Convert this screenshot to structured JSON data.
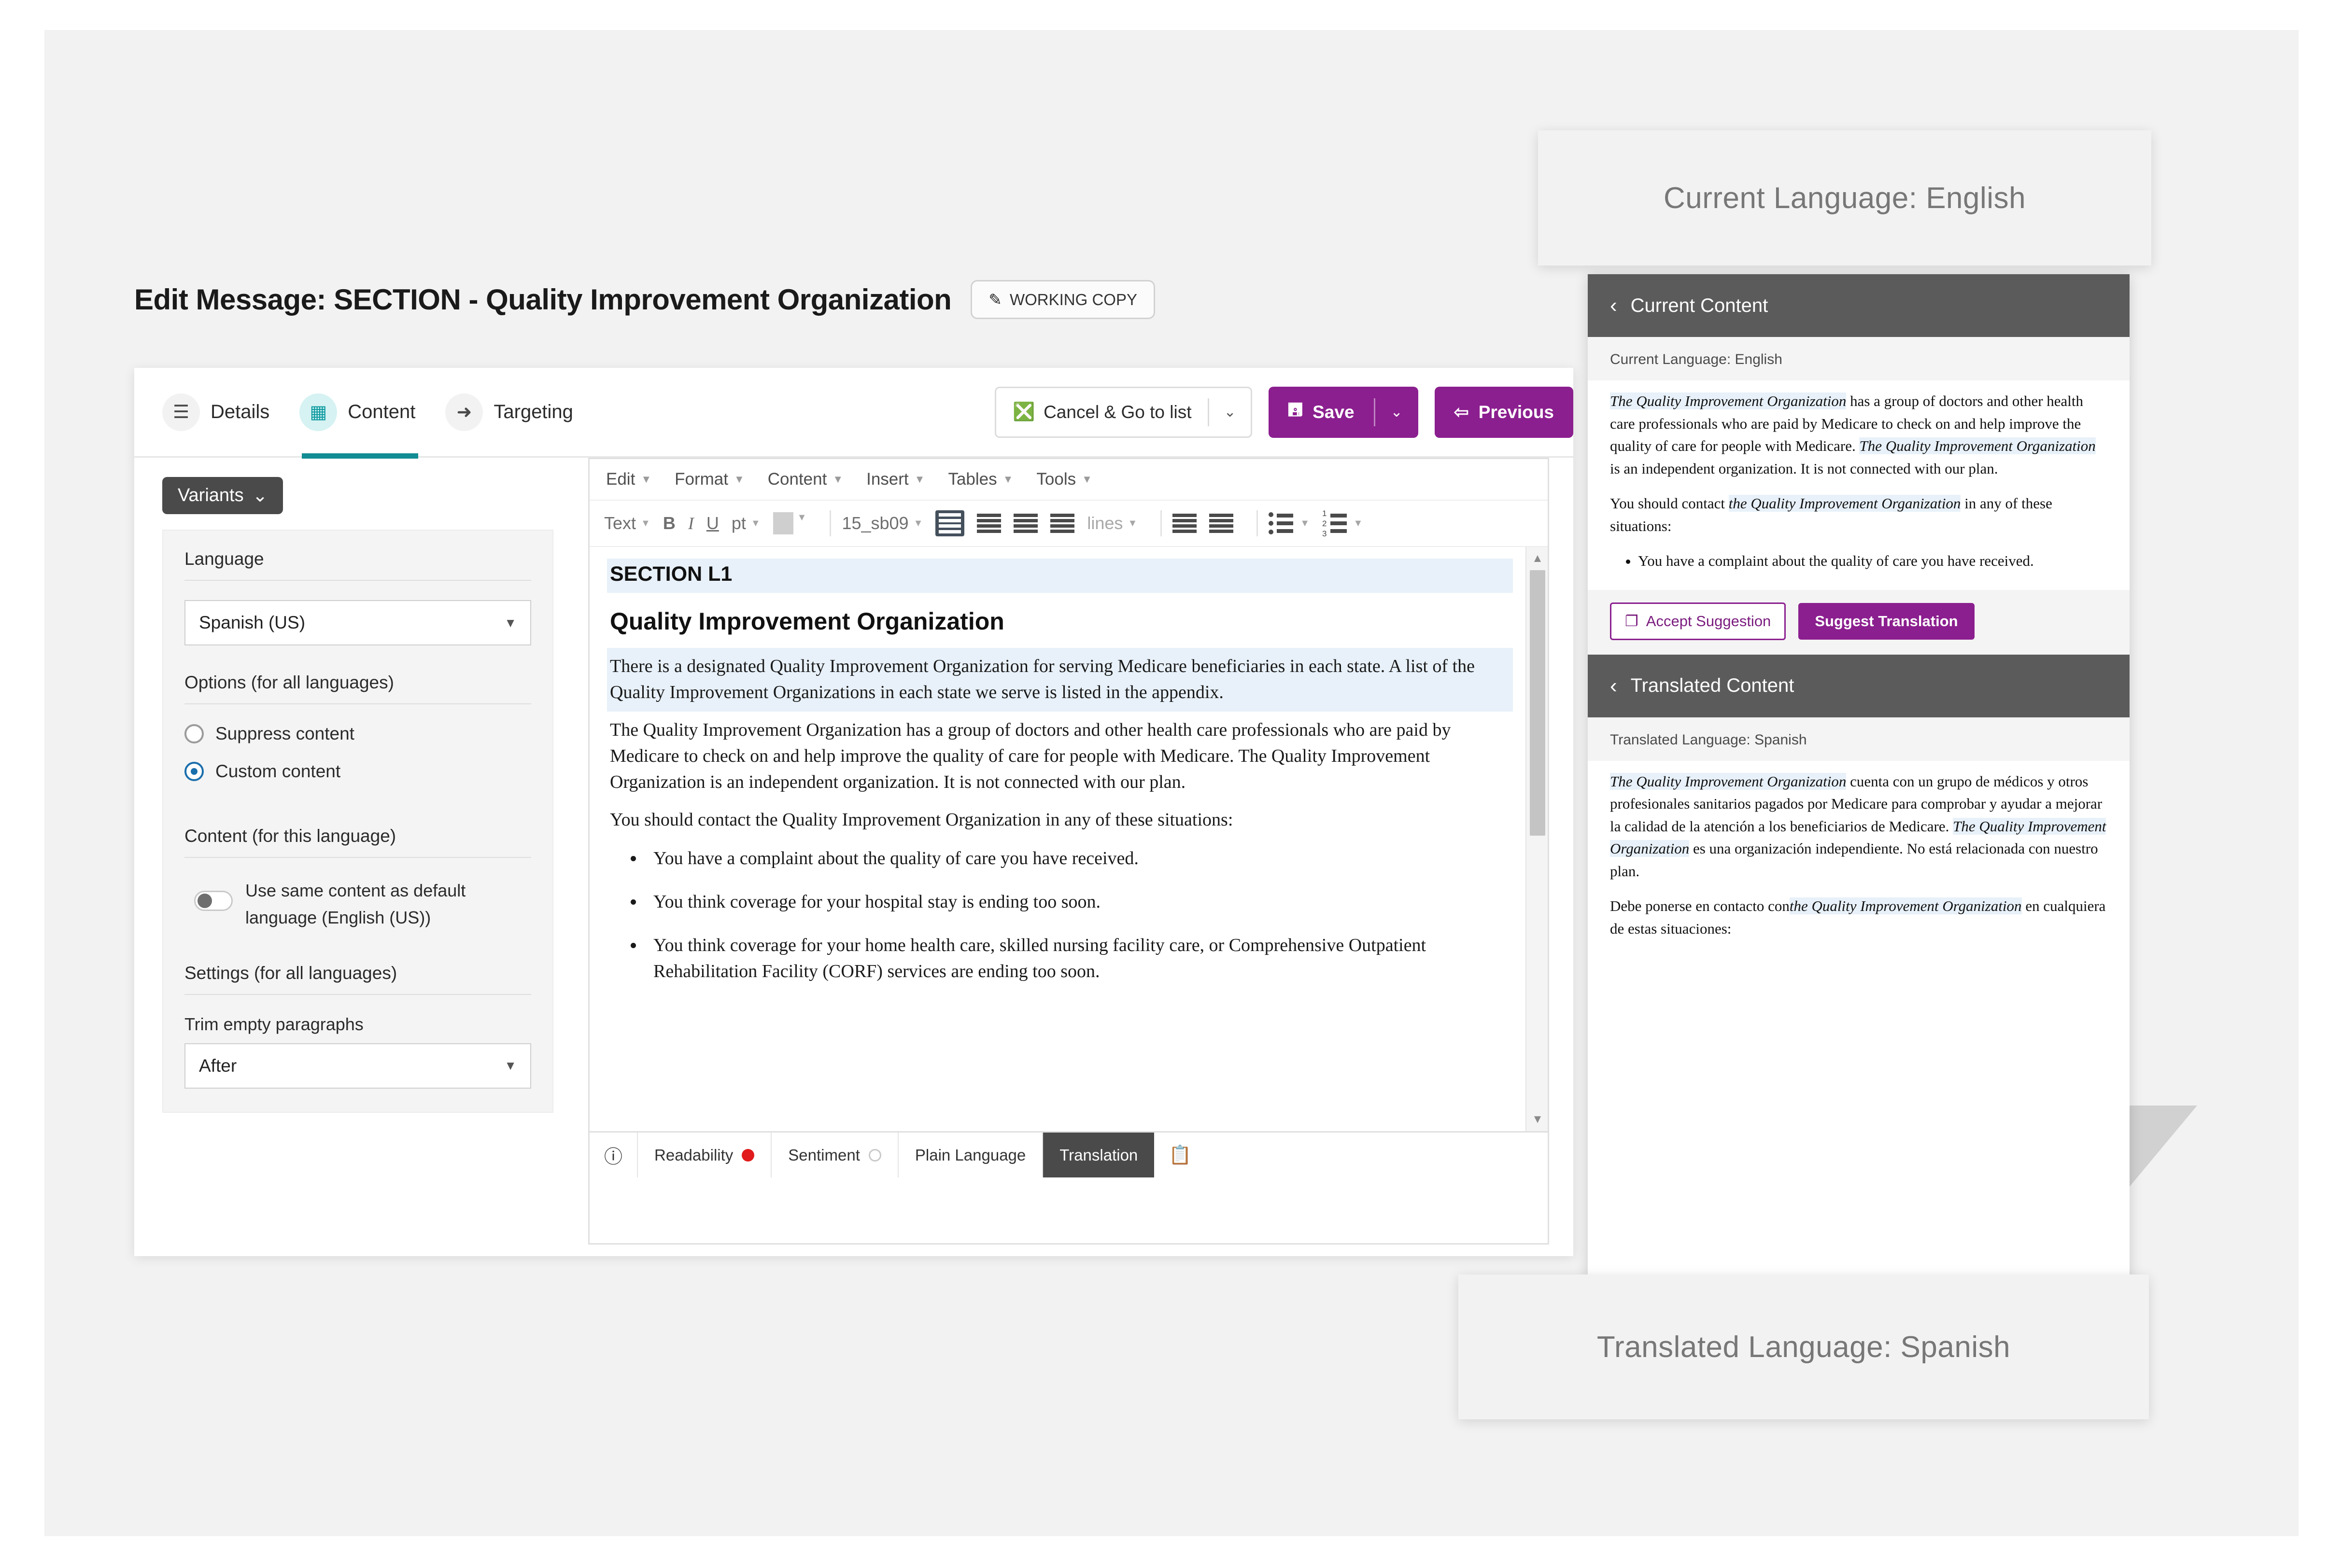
{
  "header": {
    "page_title": "Edit Message: SECTION - Quality Improvement Organization",
    "working_copy_label": "WORKING COPY",
    "working_copy_icon": "pencil-icon"
  },
  "tabs": [
    {
      "label": "Details",
      "icon": "list-icon",
      "active": false
    },
    {
      "label": "Content",
      "icon": "content-block-icon",
      "active": true
    },
    {
      "label": "Targeting",
      "icon": "target-icon",
      "active": false
    }
  ],
  "actions": {
    "cancel_label": "Cancel & Go to list",
    "cancel_icon": "circle-x-icon",
    "cancel_caret": "⌄",
    "save_label": "Save",
    "save_icon": "floppy-disk-icon",
    "save_caret": "⌄",
    "previous_label": "Previous",
    "previous_icon": "arrow-left-icon",
    "accent_purple": "#8b1f8f"
  },
  "variants": {
    "button_label": "Variants",
    "button_caret": "⌄",
    "language_label": "Language",
    "language_value": "Spanish (US)",
    "options_label": "Options (for all languages)",
    "radio_suppress": "Suppress content",
    "radio_custom": "Custom content",
    "radio_selected": "Custom content",
    "content_label": "Content (for this language)",
    "toggle_label": "Use same content as default language (English (US))",
    "toggle_on": false,
    "settings_label": "Settings (for all languages)",
    "trim_label": "Trim empty paragraphs",
    "trim_value": "After"
  },
  "editor": {
    "menus": [
      "Edit",
      "Format",
      "Content",
      "Insert",
      "Tables",
      "Tools"
    ],
    "toolbar": {
      "style_select": "Text",
      "bold": "B",
      "italic": "I",
      "underline": "U",
      "size_select": "pt",
      "color_swatch": "color-swatch",
      "font_select": "15_sb09",
      "line_spacing": "lines"
    },
    "document": {
      "section_tag": "SECTION L1",
      "heading": "Quality Improvement Organization",
      "paragraph_1": "There is a designated Quality Improvement Organization for serving Medicare beneficiaries in each state. A list of the Quality Improvement Organizations in each state we serve is listed in the appendix.",
      "paragraph_2": "The Quality Improvement Organization has a group of doctors and other health care professionals who are paid by Medicare to check on and help improve the quality of care for people with Medicare. The Quality Improvement Organization is an independent organization. It is not connected with our plan.",
      "paragraph_3": "You should contact the Quality Improvement Organization in any of these situations:",
      "bullets": [
        "You have a complaint about the quality of care you have received.",
        "You think coverage for your hospital stay is ending too soon.",
        "You think coverage for your home health care, skilled nursing facility care, or Comprehensive Outpatient Rehabilitation Facility (CORF) services are ending too soon."
      ]
    },
    "status_bar": {
      "info_icon": "info-circle-icon",
      "readability_label": "Readability",
      "readability_status_color": "#e11b1b",
      "sentiment_label": "Sentiment",
      "sentiment_status_color": "#ffffff",
      "plain_language_label": "Plain Language",
      "translation_label": "Translation",
      "translation_selected": true,
      "clipboard_icon": "clipboard-icon"
    }
  },
  "translation_panel": {
    "current": {
      "header": "Current Content",
      "back_icon": "chevron-left-icon",
      "language_line": "Current Language: English",
      "paragraph_1_em": "The Quality Improvement Organization",
      "paragraph_1_rest": " has a group of doctors and other health care professionals who are paid by Medicare to check on and help improve the quality of care for people with Medicare. ",
      "paragraph_1_em2": "The Quality Improvement Organization",
      "paragraph_1_tail": " is an independent organization. It is not connected with our plan.",
      "paragraph_2_head": "You should contact ",
      "paragraph_2_em": "the Quality Improvement Organization",
      "paragraph_2_tail": " in any of these situations:",
      "bullets": [
        "You have a complaint about the quality of care you have received."
      ]
    },
    "buttons": {
      "accept_label": "Accept Suggestion",
      "accept_icon": "copy-icon",
      "suggest_label": "Suggest Translation"
    },
    "translated": {
      "header": "Translated Content",
      "back_icon": "chevron-left-icon",
      "language_line": "Translated Language: Spanish",
      "paragraph_1_em": "The Quality Improvement Organization",
      "paragraph_1_rest": " cuenta con un grupo de médicos y otros profesionales sanitarios pagados por Medicare para comprobar y ayudar a mejorar la calidad de la atención a los beneficiarios de Medicare. ",
      "paragraph_1_em2": "The Quality Improvement Organization",
      "paragraph_1_tail": " es una organización independiente. No está relacionada con nuestro plan.",
      "paragraph_2_head": "Debe ponerse en contacto con",
      "paragraph_2_em": "the Quality Improvement Organization",
      "paragraph_2_tail": " en cualquiera de estas situaciones:"
    }
  },
  "callouts": {
    "top": "Current Language: English",
    "bottom": "Translated Language: Spanish"
  }
}
